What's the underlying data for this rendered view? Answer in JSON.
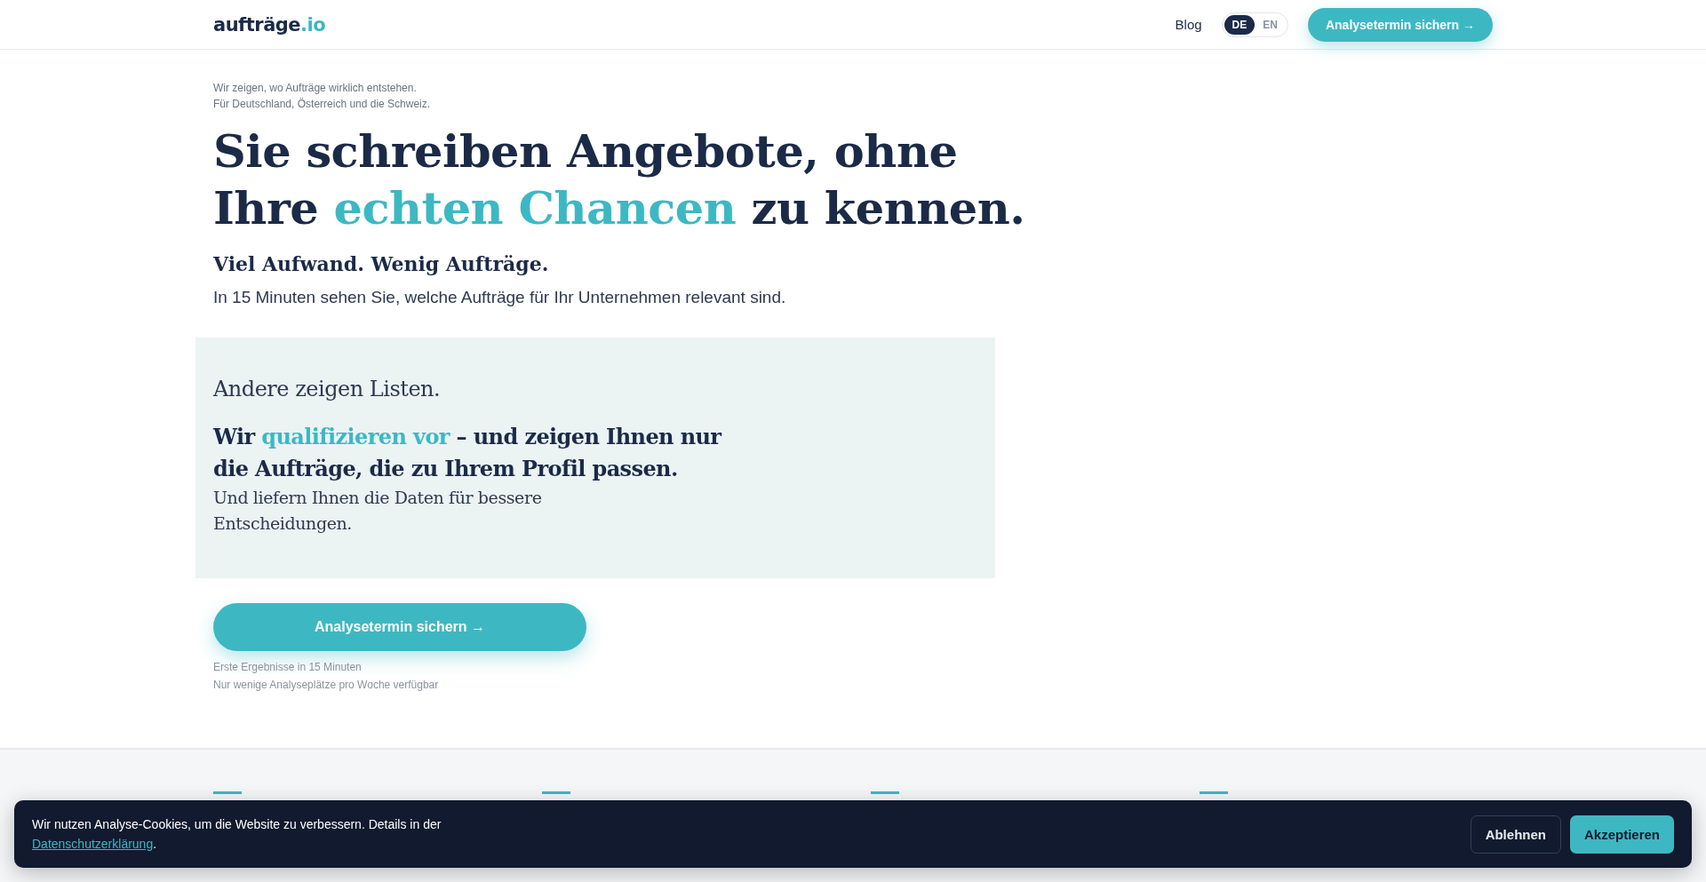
{
  "header": {
    "logo": [
      {
        "text": "aufträge",
        "accent": false
      },
      {
        "text": ".io",
        "accent": true
      }
    ],
    "nav": [
      {
        "label": "Blog"
      }
    ],
    "languages": [
      {
        "label": "DE",
        "selected": true
      },
      {
        "label": "EN",
        "selected": false
      }
    ],
    "cta": "Analysetermin sichern →"
  },
  "hero": {
    "eyebrow": [
      "Wir zeigen, wo Aufträge wirklich entstehen.",
      "Für Deutschland, Österreich und die Schweiz."
    ],
    "headline": [
      [
        {
          "text": "Sie schreiben Angebote, ohne",
          "accent": false
        }
      ],
      [
        {
          "text": "Ihre ",
          "accent": false
        },
        {
          "text": "echten Chancen",
          "accent": true
        },
        {
          "text": " zu kennen.",
          "accent": false
        }
      ]
    ],
    "subheadline": "Viel Aufwand. Wenig Aufträge.",
    "lead": "In 15 Minuten sehen Sie, welche Aufträge für Ihr Unternehmen relevant sind.",
    "box": {
      "intro": "Andere zeigen Listen.",
      "statement": [
        [
          {
            "text": "Wir ",
            "accent": false
          },
          {
            "text": "qualifizieren vor",
            "accent": true
          },
          {
            "text": " – und zeigen Ihnen nur",
            "accent": false
          }
        ],
        [
          {
            "text": "die Aufträge, die zu Ihrem Profil passen.",
            "accent": false
          }
        ]
      ],
      "detail": [
        "Und liefern Ihnen die Daten für bessere",
        "Entscheidungen."
      ]
    },
    "cta": "Analysetermin sichern →",
    "notes": [
      "Erste Ergebnisse in 15 Minuten",
      "Nur wenige Analyseplätze pro Woche verfügbar"
    ]
  },
  "cookie_banner": {
    "text": "Wir nutzen Analyse-Cookies, um die Website zu verbessern. Details in der",
    "link": "Datenschutzerklärung",
    "after_link": ".",
    "buttons": [
      {
        "label": "Ablehnen",
        "kind": "secondary"
      },
      {
        "label": "Akzeptieren",
        "kind": "primary"
      }
    ]
  }
}
